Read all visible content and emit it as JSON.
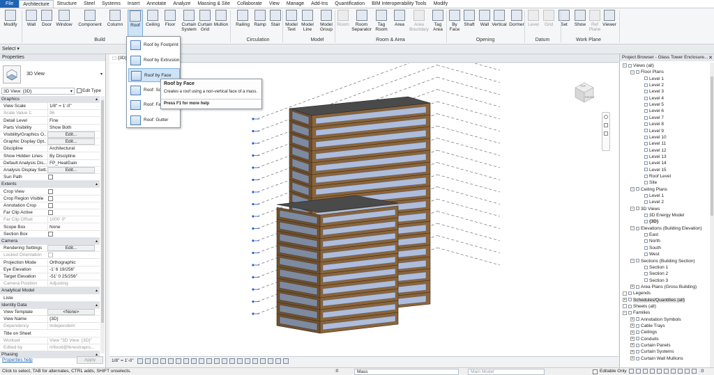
{
  "tabs": [
    "File",
    "Architecture",
    "Structure",
    "Steel",
    "Systems",
    "Insert",
    "Annotate",
    "Analyze",
    "Massing & Site",
    "Collaborate",
    "View",
    "Manage",
    "Add-Ins",
    "Quantification",
    "BIM Interoperability Tools",
    "Modify"
  ],
  "active_tab": "Architecture",
  "ribbon": {
    "buttons": [
      {
        "label": "Modify",
        "key": "modify"
      },
      {
        "label": "Wall",
        "key": "wall"
      },
      {
        "label": "Door",
        "key": "door"
      },
      {
        "label": "Window",
        "key": "window"
      },
      {
        "label": "Component",
        "key": "component"
      },
      {
        "label": "Column",
        "key": "column"
      },
      {
        "label": "Roof",
        "key": "roof"
      },
      {
        "label": "Ceiling",
        "key": "ceiling"
      },
      {
        "label": "Floor",
        "key": "floor"
      },
      {
        "label": "Curtain System",
        "key": "curtain-system"
      },
      {
        "label": "Curtain Grid",
        "key": "curtain-grid"
      },
      {
        "label": "Mullion",
        "key": "mullion"
      },
      {
        "label": "Railing",
        "key": "railing"
      },
      {
        "label": "Ramp",
        "key": "ramp"
      },
      {
        "label": "Stair",
        "key": "stair"
      },
      {
        "label": "Model Text",
        "key": "model-text"
      },
      {
        "label": "Model Line",
        "key": "model-line"
      },
      {
        "label": "Model Group",
        "key": "model-group"
      },
      {
        "label": "Room",
        "key": "room"
      },
      {
        "label": "Room Separator",
        "key": "room-separator"
      },
      {
        "label": "Tag Room",
        "key": "tag-room"
      },
      {
        "label": "Area",
        "key": "area"
      },
      {
        "label": "Area Boundary",
        "key": "area-boundary"
      },
      {
        "label": "Tag Area",
        "key": "tag-area"
      },
      {
        "label": "By Face",
        "key": "by-face"
      },
      {
        "label": "Shaft",
        "key": "shaft"
      },
      {
        "label": "Wall",
        "key": "opening-wall"
      },
      {
        "label": "Vertical",
        "key": "vertical"
      },
      {
        "label": "Dormer",
        "key": "dormer"
      },
      {
        "label": "Level",
        "key": "level"
      },
      {
        "label": "Grid",
        "key": "grid"
      },
      {
        "label": "Set",
        "key": "set"
      },
      {
        "label": "Show",
        "key": "show"
      },
      {
        "label": "Ref Plane",
        "key": "ref-plane"
      },
      {
        "label": "Viewer",
        "key": "viewer"
      }
    ],
    "groups": [
      "Select",
      "Build",
      "Circulation",
      "Model",
      "Room & Area",
      "Opening",
      "Datum",
      "Work Plane"
    ],
    "select_label": "Select ▾"
  },
  "roof_menu": {
    "items": [
      "Roof by Footprint",
      "Roof by Extrusion",
      "Roof by Face",
      "Roof: Soffit",
      "Roof: Fascia",
      "Roof: Gutter"
    ],
    "highlighted": "Roof by Face"
  },
  "tooltip": {
    "title": "Roof by Face",
    "text": "Creates a roof using a non-vertical face of a mass.",
    "help": "Press F1 for more help"
  },
  "properties": {
    "title": "Properties",
    "type_name": "3D View",
    "selector": "3D View: {3D}",
    "edit_type": "Edit Type",
    "apply": "Apply",
    "help_link": "Properties help",
    "rows": [
      {
        "cat": "Graphics"
      },
      {
        "k": "View Scale",
        "v": "1/8\" = 1'-0\""
      },
      {
        "k": "Scale Value    1:",
        "v": "96",
        "grey": true
      },
      {
        "k": "Detail Level",
        "v": "Fine"
      },
      {
        "k": "Parts Visibility",
        "v": "Show Both"
      },
      {
        "k": "Visibility/Graphics O...",
        "btn": "Edit..."
      },
      {
        "k": "Graphic Display Opt...",
        "btn": "Edit..."
      },
      {
        "k": "Discipline",
        "v": "Architectural"
      },
      {
        "k": "Show Hidden Lines",
        "v": "By Discipline"
      },
      {
        "k": "Default Analysis Dis...",
        "v": "FP_HeatGain"
      },
      {
        "k": "Analysis Display Sett...",
        "btn": "Edit..."
      },
      {
        "k": "Sun Path",
        "chk": true
      },
      {
        "cat": "Extents"
      },
      {
        "k": "Crop View",
        "chk": true
      },
      {
        "k": "Crop Region Visible",
        "chk": true
      },
      {
        "k": "Annotation Crop",
        "chk": true
      },
      {
        "k": "Far Clip Active",
        "chk": true
      },
      {
        "k": "Far Clip Offset",
        "v": "1000'  0\"",
        "grey": true
      },
      {
        "k": "Scope Box",
        "v": "None"
      },
      {
        "k": "Section Box",
        "chk": true
      },
      {
        "cat": "Camera"
      },
      {
        "k": "Rendering Settings",
        "btn": "Edit..."
      },
      {
        "k": "Locked Orientation",
        "chk": true,
        "grey": true
      },
      {
        "k": "Projection Mode",
        "v": "Orthographic"
      },
      {
        "k": "Eye Elevation",
        "v": "-1'  6 19/256\""
      },
      {
        "k": "Target Elevation",
        "v": "-51'  0 25/256\""
      },
      {
        "k": "Camera Position",
        "v": "Adjusting",
        "grey": true
      },
      {
        "cat": "Analytical Model"
      },
      {
        "k": "Liste",
        "v": ""
      },
      {
        "cat": "Identity Data"
      },
      {
        "k": "View Template",
        "btn": "<None>"
      },
      {
        "k": "View Name",
        "v": "{3D}"
      },
      {
        "k": "Dependency",
        "v": "Independent",
        "grey": true
      },
      {
        "k": "Title on Sheet",
        "v": ""
      },
      {
        "k": "Workset",
        "v": "View \"3D View: {3D}\"",
        "grey": true
      },
      {
        "k": "Edited by",
        "v": "mflood@fenestrapro...",
        "grey": true
      },
      {
        "cat": "Phasing"
      }
    ]
  },
  "view": {
    "tab_label": "{3D}",
    "scale": "1/8\" = 1'-0\"",
    "cube_faces": [
      "TOP",
      "FRONT"
    ]
  },
  "browser": {
    "title": "Project Browser - Glass Tower Enclosure...",
    "items": [
      {
        "t": "Views (all)",
        "lvl": 0,
        "tg": "−"
      },
      {
        "t": "Floor Plans",
        "lvl": 1,
        "tg": "−"
      },
      {
        "t": "Level 1",
        "lvl": 2
      },
      {
        "t": "Level 2",
        "lvl": 2
      },
      {
        "t": "Level 3",
        "lvl": 2
      },
      {
        "t": "Level 4",
        "lvl": 2
      },
      {
        "t": "Level 5",
        "lvl": 2
      },
      {
        "t": "Level 6",
        "lvl": 2
      },
      {
        "t": "Level 7",
        "lvl": 2
      },
      {
        "t": "Level 8",
        "lvl": 2
      },
      {
        "t": "Level 9",
        "lvl": 2
      },
      {
        "t": "Level 10",
        "lvl": 2
      },
      {
        "t": "Level 11",
        "lvl": 2
      },
      {
        "t": "Level 12",
        "lvl": 2
      },
      {
        "t": "Level 13",
        "lvl": 2
      },
      {
        "t": "Level 14",
        "lvl": 2
      },
      {
        "t": "Level 15",
        "lvl": 2
      },
      {
        "t": "Roof Level",
        "lvl": 2
      },
      {
        "t": "Site",
        "lvl": 2
      },
      {
        "t": "Ceiling Plans",
        "lvl": 1,
        "tg": "−"
      },
      {
        "t": "Level 1",
        "lvl": 2
      },
      {
        "t": "Level 2",
        "lvl": 2
      },
      {
        "t": "3D Views",
        "lvl": 1,
        "tg": "−"
      },
      {
        "t": "3D Energy Model",
        "lvl": 2
      },
      {
        "t": "{3D}",
        "lvl": 2,
        "bold": true
      },
      {
        "t": "Elevations (Building Elevation)",
        "lvl": 1,
        "tg": "−"
      },
      {
        "t": "East",
        "lvl": 2
      },
      {
        "t": "North",
        "lvl": 2
      },
      {
        "t": "South",
        "lvl": 2
      },
      {
        "t": "West",
        "lvl": 2
      },
      {
        "t": "Sections (Building Section)",
        "lvl": 1,
        "tg": "−"
      },
      {
        "t": "Section 1",
        "lvl": 2
      },
      {
        "t": "Section 2",
        "lvl": 2
      },
      {
        "t": "Section 3",
        "lvl": 2
      },
      {
        "t": "Area Plans (Gross Building)",
        "lvl": 1,
        "tg": "+"
      },
      {
        "t": "Legends",
        "lvl": 0,
        "tg": " "
      },
      {
        "t": "Schedules/Quantities (all)",
        "lvl": 0,
        "tg": "+",
        "hl": true
      },
      {
        "t": "Sheets (all)",
        "lvl": 0,
        "tg": " "
      },
      {
        "t": "Families",
        "lvl": 0,
        "tg": "−"
      },
      {
        "t": "Annotation Symbols",
        "lvl": 1,
        "tg": "+"
      },
      {
        "t": "Cable Trays",
        "lvl": 1,
        "tg": "+"
      },
      {
        "t": "Ceilings",
        "lvl": 1,
        "tg": "+"
      },
      {
        "t": "Conduits",
        "lvl": 1,
        "tg": "+"
      },
      {
        "t": "Curtain Panels",
        "lvl": 1,
        "tg": "+"
      },
      {
        "t": "Curtain Systems",
        "lvl": 1,
        "tg": "+"
      },
      {
        "t": "Curtain Wall Mullions",
        "lvl": 1,
        "tg": "+"
      }
    ]
  },
  "status": {
    "message": "Click to select, TAB for alternates, CTRL adds, SHIFT unselects.",
    "zero": ":0",
    "workset": "Mass",
    "design_option": "Main Model",
    "editable_only": "Editable Only",
    "filter_count": ":0"
  }
}
